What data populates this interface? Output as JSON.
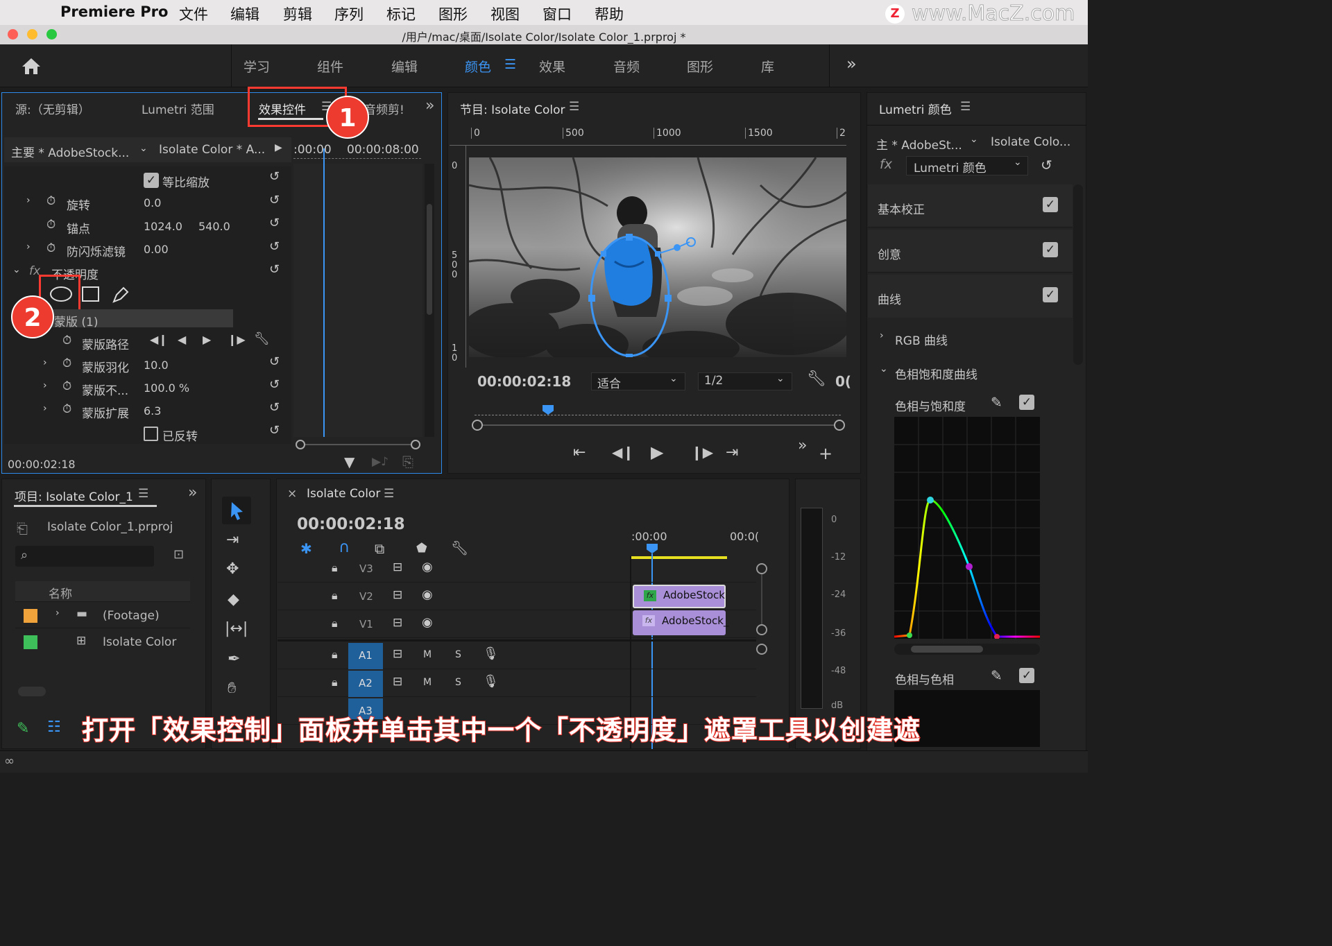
{
  "menubar": {
    "app": "Premiere Pro",
    "items": [
      "文件",
      "编辑",
      "剪辑",
      "序列",
      "标记",
      "图形",
      "视图",
      "窗口",
      "帮助"
    ],
    "watermark": "www.MacZ.com",
    "watermark_logo": "Z"
  },
  "window": {
    "title": "/用户/mac/桌面/Isolate Color/Isolate Color_1.prproj *"
  },
  "workspaces": {
    "tabs": [
      "学习",
      "组件",
      "编辑",
      "颜色",
      "效果",
      "音频",
      "图形",
      "库"
    ],
    "active": "颜色"
  },
  "effect_controls": {
    "tabs": {
      "source": "源:（无剪辑）",
      "scopes": "Lumetri 范围",
      "effects": "效果控件",
      "audio": "音频剪!"
    },
    "master": "主要 * AdobeStock...",
    "sequence": "Isolate Color * A...",
    "time_start": ":00:00",
    "time_end": "00:00:08:00",
    "uniform_scale": "等比缩放",
    "rotation": {
      "label": "旋转",
      "value": "0.0"
    },
    "anchor": {
      "label": "锚点",
      "x": "1024.0",
      "y": "540.0"
    },
    "antiflicker": {
      "label": "防闪烁滤镜",
      "value": "0.00"
    },
    "opacity": {
      "label": "不透明度",
      "fx": "fx"
    },
    "mask": {
      "label": "蒙版 (1)"
    },
    "mask_path": "蒙版路径",
    "mask_feather": {
      "label": "蒙版羽化",
      "value": "10.0"
    },
    "mask_opacity": {
      "label": "蒙版不...",
      "value": "100.0 %"
    },
    "mask_expansion": {
      "label": "蒙版扩展",
      "value": "6.3"
    },
    "inverted": "已反转",
    "timecode": "00:00:02:18",
    "playhead_fraction": 0.06
  },
  "program": {
    "title": "节目: Isolate Color",
    "ruler": [
      "0",
      "500",
      "1000",
      "1500",
      "2"
    ],
    "vruler": [
      "0",
      "5\n0\n0",
      "1\n0"
    ],
    "timecode": "00:00:02:18",
    "fit": "适合",
    "quality": "1/2",
    "extra_timecode": "0("
  },
  "lumetri": {
    "title": "Lumetri 颜色",
    "master": "主 * AdobeSt...",
    "sequence": "Isolate Colo...",
    "fx_select": "Lumetri 颜色",
    "sections": [
      "基本校正",
      "创意",
      "曲线"
    ],
    "rgb_curves": "RGB 曲线",
    "hue_sat_curves": "色相饱和度曲线",
    "hue_vs_sat": "色相与饱和度",
    "hue_vs_hue": "色相与色相"
  },
  "project": {
    "title": "项目: Isolate Color_1",
    "file": "Isolate Color_1.prproj",
    "column": "名称",
    "items": [
      {
        "name": "(Footage)",
        "color": "#f0a33a"
      },
      {
        "name": "Isolate Color",
        "color": "#3fbf5a"
      }
    ]
  },
  "timeline": {
    "title": "Isolate Color",
    "timecode": "00:00:02:18",
    "ruler": [
      ":00:00",
      "00:0("
    ],
    "tracks": [
      "V3",
      "V2",
      "V1",
      "A1",
      "A2",
      "A3"
    ],
    "clips": [
      "AdobeStock",
      "AdobeStock_"
    ],
    "audio_labels": {
      "m": "M",
      "s": "S"
    },
    "meter": [
      "0",
      "-12",
      "-24",
      "-36",
      "-48",
      "dB"
    ]
  },
  "caption": "打开「效果控制」面板并单击其中一个「不透明度」遮罩工具以创建遮",
  "badges": [
    "1",
    "2"
  ],
  "colors": {
    "accent": "#2d8ceb",
    "highlight": "#ff3a30",
    "clip": "#a98fd8"
  }
}
